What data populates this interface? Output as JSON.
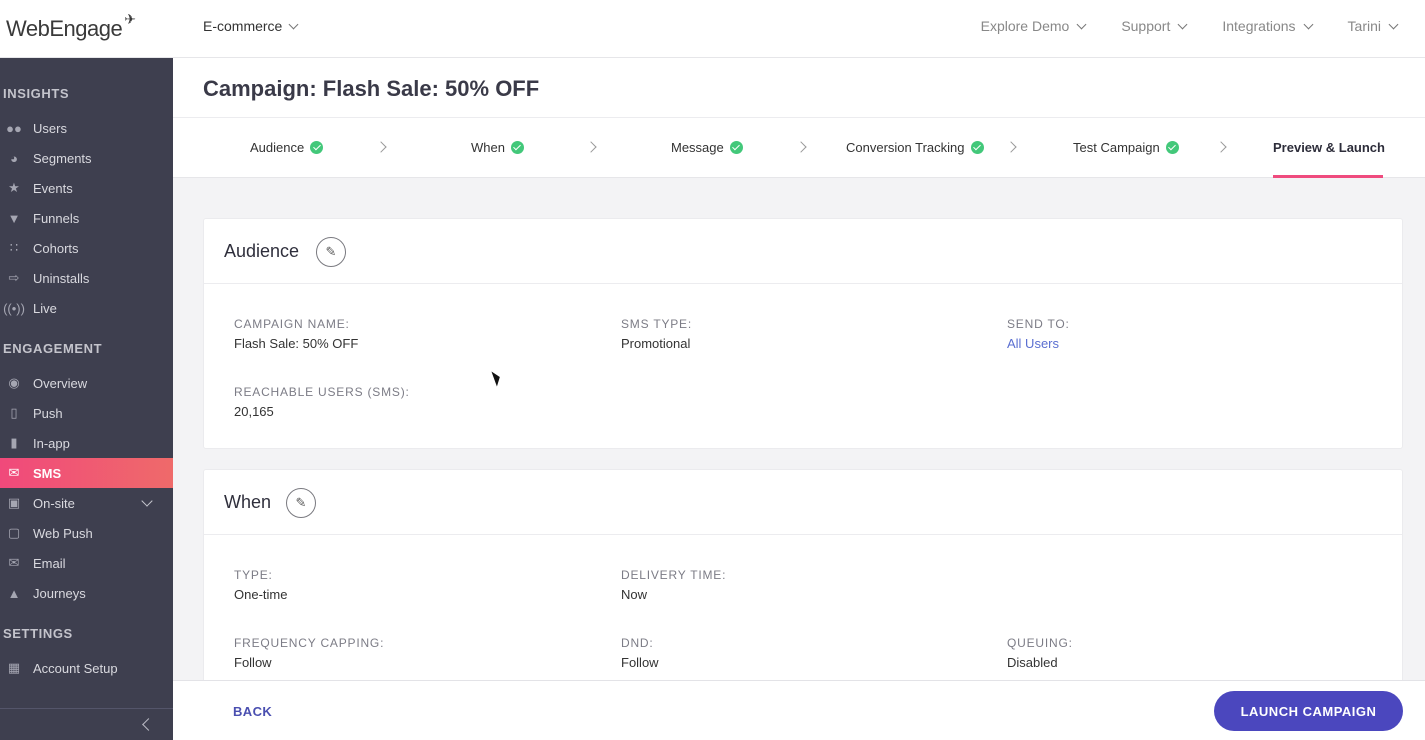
{
  "topbar": {
    "logo_text": "WebEngage",
    "project": "E-commerce",
    "nav": [
      "Explore Demo",
      "Support",
      "Integrations",
      "Tarini"
    ]
  },
  "sidebar": {
    "sections": {
      "insights": "INSIGHTS",
      "engagement": "ENGAGEMENT",
      "settings": "SETTINGS"
    },
    "insights_items": [
      {
        "label": "Users",
        "icon": "users-icon"
      },
      {
        "label": "Segments",
        "icon": "pie-icon"
      },
      {
        "label": "Events",
        "icon": "star-icon"
      },
      {
        "label": "Funnels",
        "icon": "funnel-icon"
      },
      {
        "label": "Cohorts",
        "icon": "grid-icon"
      },
      {
        "label": "Uninstalls",
        "icon": "exit-icon"
      },
      {
        "label": "Live",
        "icon": "broadcast-icon"
      }
    ],
    "engagement_items": [
      {
        "label": "Overview",
        "icon": "eye-icon"
      },
      {
        "label": "Push",
        "icon": "phone-icon"
      },
      {
        "label": "In-app",
        "icon": "tablet-icon"
      },
      {
        "label": "SMS",
        "icon": "sms-icon",
        "active": true
      },
      {
        "label": "On-site",
        "icon": "window-icon"
      },
      {
        "label": "Web Push",
        "icon": "webpush-icon"
      },
      {
        "label": "Email",
        "icon": "mail-icon"
      },
      {
        "label": "Journeys",
        "icon": "rocket-icon"
      }
    ],
    "settings_items": [
      {
        "label": "Account Setup",
        "icon": "dashboard-icon"
      }
    ]
  },
  "page": {
    "title": "Campaign: Flash Sale: 50% OFF"
  },
  "steps": [
    {
      "label": "Audience",
      "done": true
    },
    {
      "label": "When",
      "done": true
    },
    {
      "label": "Message",
      "done": true
    },
    {
      "label": "Conversion Tracking",
      "done": true
    },
    {
      "label": "Test Campaign",
      "done": true
    },
    {
      "label": "Preview & Launch",
      "active": true
    }
  ],
  "audience_card": {
    "title": "Audience",
    "campaign_name_label": "CAMPAIGN NAME:",
    "campaign_name": "Flash Sale: 50% OFF",
    "sms_type_label": "SMS TYPE:",
    "sms_type": "Promotional",
    "send_to_label": "SEND TO:",
    "send_to": "All Users",
    "reachable_label": "REACHABLE USERS (SMS):",
    "reachable": "20,165"
  },
  "when_card": {
    "title": "When",
    "type_label": "TYPE:",
    "type": "One-time",
    "delivery_label": "DELIVERY TIME:",
    "delivery": "Now",
    "frequency_label": "FREQUENCY CAPPING:",
    "frequency": "Follow",
    "dnd_label": "DND:",
    "dnd": "Follow",
    "queuing_label": "QUEUING:",
    "queuing": "Disabled"
  },
  "footer": {
    "back": "BACK",
    "launch": "LAUNCH CAMPAIGN"
  },
  "colors": {
    "accent": "#ef4b7e",
    "primary": "#4b47be",
    "sidebar": "#3e3f4f",
    "success": "#43c87a"
  }
}
